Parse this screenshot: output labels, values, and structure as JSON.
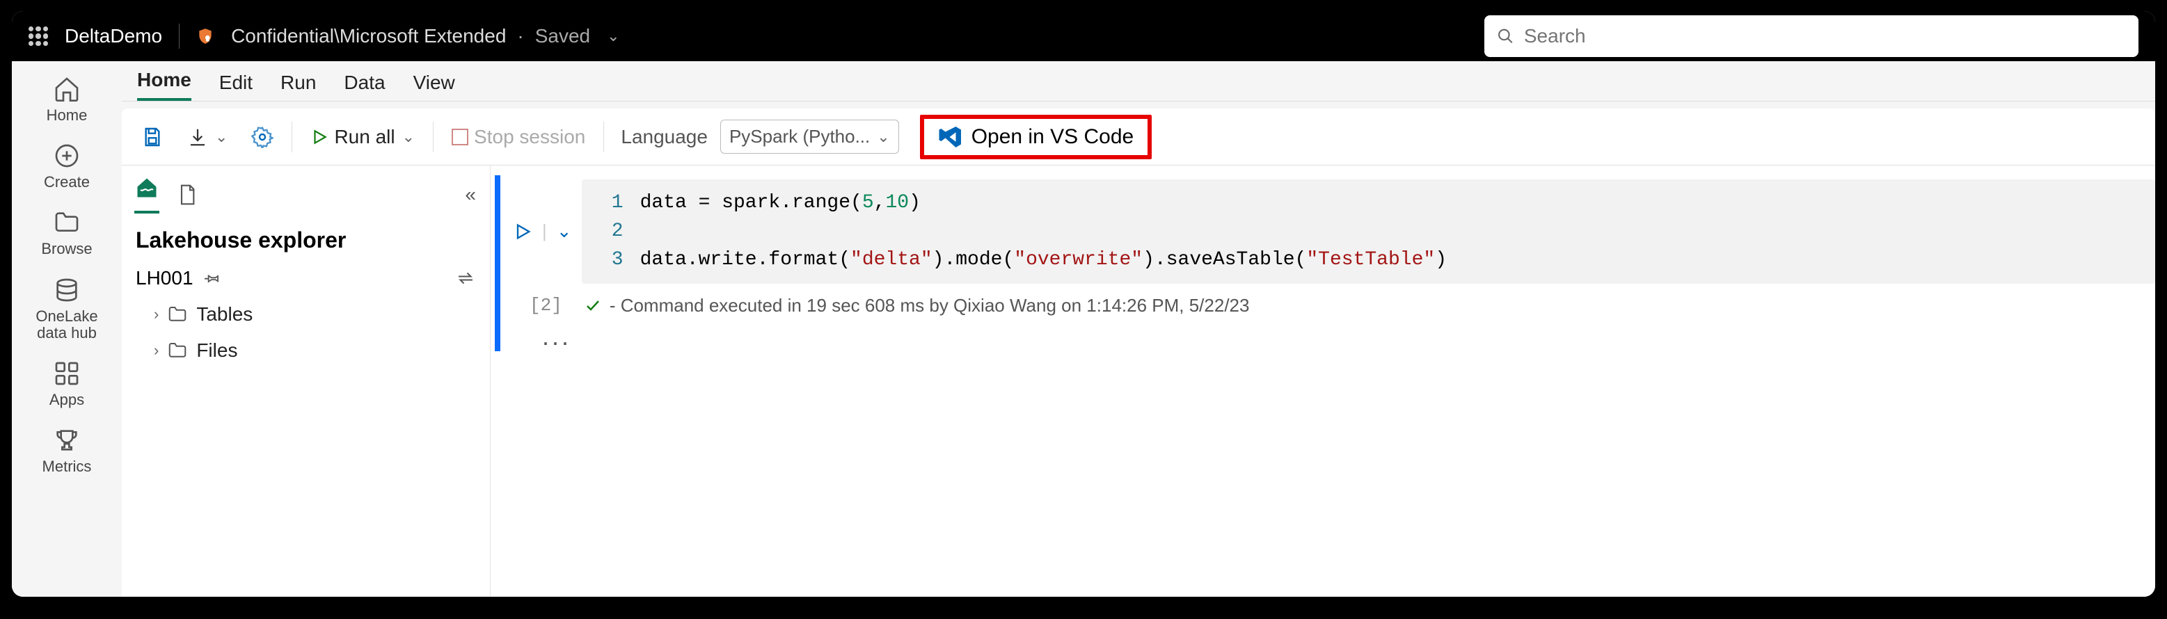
{
  "topbar": {
    "title": "DeltaDemo",
    "classification": "Confidential\\Microsoft Extended",
    "saved": "Saved",
    "search_placeholder": "Search"
  },
  "leftnav": {
    "home": "Home",
    "create": "Create",
    "browse": "Browse",
    "onelake": "OneLake\ndata hub",
    "apps": "Apps",
    "metrics": "Metrics"
  },
  "tabs": {
    "home": "Home",
    "edit": "Edit",
    "run": "Run",
    "data": "Data",
    "view": "View"
  },
  "toolbar": {
    "run_all": "Run all",
    "stop_session": "Stop session",
    "language_label": "Language",
    "language_value": "PySpark (Pytho...",
    "open_vscode": "Open in VS Code"
  },
  "explorer": {
    "title": "Lakehouse explorer",
    "lakehouse_name": "LH001",
    "tables": "Tables",
    "files": "Files"
  },
  "editor": {
    "cell_index": "[2]",
    "lines": [
      {
        "n": "1",
        "tokens": [
          [
            "plain",
            "data = spark.range("
          ],
          [
            "num",
            "5"
          ],
          [
            "plain",
            ","
          ],
          [
            "num",
            "10"
          ],
          [
            "plain",
            ")"
          ]
        ]
      },
      {
        "n": "2",
        "tokens": []
      },
      {
        "n": "3",
        "tokens": [
          [
            "plain",
            "data.write.format("
          ],
          [
            "str",
            "\"delta\""
          ],
          [
            "plain",
            ").mode("
          ],
          [
            "str",
            "\"overwrite\""
          ],
          [
            "plain",
            ").saveAsTable("
          ],
          [
            "str",
            "\"TestTable\""
          ],
          [
            "plain",
            ")"
          ]
        ]
      }
    ],
    "status": "- Command executed in 19 sec 608 ms by Qixiao Wang on 1:14:26 PM, 5/22/23",
    "more": "..."
  }
}
